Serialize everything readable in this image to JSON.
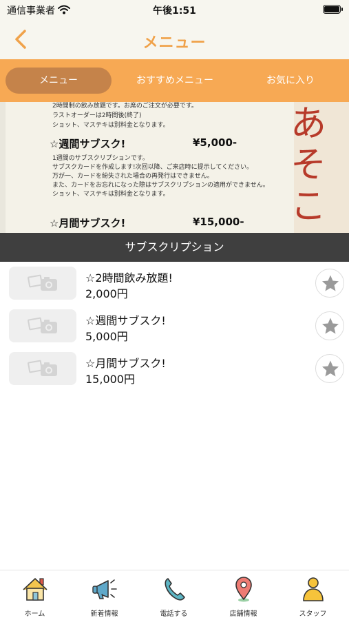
{
  "status": {
    "carrier": "通信事業者",
    "time": "午後1:51"
  },
  "nav": {
    "title": "メニュー"
  },
  "tabs": [
    {
      "label": "メニュー",
      "active": true
    },
    {
      "label": "おすすめメニュー",
      "active": false
    },
    {
      "label": "お気に入り",
      "active": false
    }
  ],
  "hero": {
    "lines": [
      "2時間制の飲み放題です。お席のご注文が必要です。",
      "ラストオーダーは2時間後(終了)",
      "ショット、マステキは別料金となります。",
      "1週間のサブスクリプションです。",
      "サブスクカードを作成します!次回以降、ご来店時に提示してください。",
      "万が一、カードを紛失された場合の再発行はできません。",
      "また、カードをお忘れになった際はサブスクリプションの適用ができません。",
      "ショット、マステキは別料金となります。"
    ],
    "heading_week": "☆週間サブスク!",
    "price_week": "¥5,000-",
    "heading_month": "☆月間サブスク!",
    "price_month": "¥15,000-",
    "deco_chars": "あそこ"
  },
  "section": {
    "title": "サブスクリプション"
  },
  "items": [
    {
      "name": "☆2時間飲み放題!",
      "price": "2,000円"
    },
    {
      "name": "☆週間サブスク!",
      "price": "5,000円"
    },
    {
      "name": "☆月間サブスク!",
      "price": "15,000円"
    }
  ],
  "bottom_nav": [
    {
      "label": "ホーム",
      "icon": "home-icon"
    },
    {
      "label": "新着情報",
      "icon": "megaphone-icon"
    },
    {
      "label": "電話する",
      "icon": "phone-icon"
    },
    {
      "label": "店舗情報",
      "icon": "map-pin-icon"
    },
    {
      "label": "スタッフ",
      "icon": "staff-icon"
    }
  ],
  "colors": {
    "accent": "#f0a24a",
    "tab_bar": "#f7a954",
    "tab_active": "#c5834a",
    "section_header": "#3f3f3f",
    "star": "#9a9a9a"
  }
}
